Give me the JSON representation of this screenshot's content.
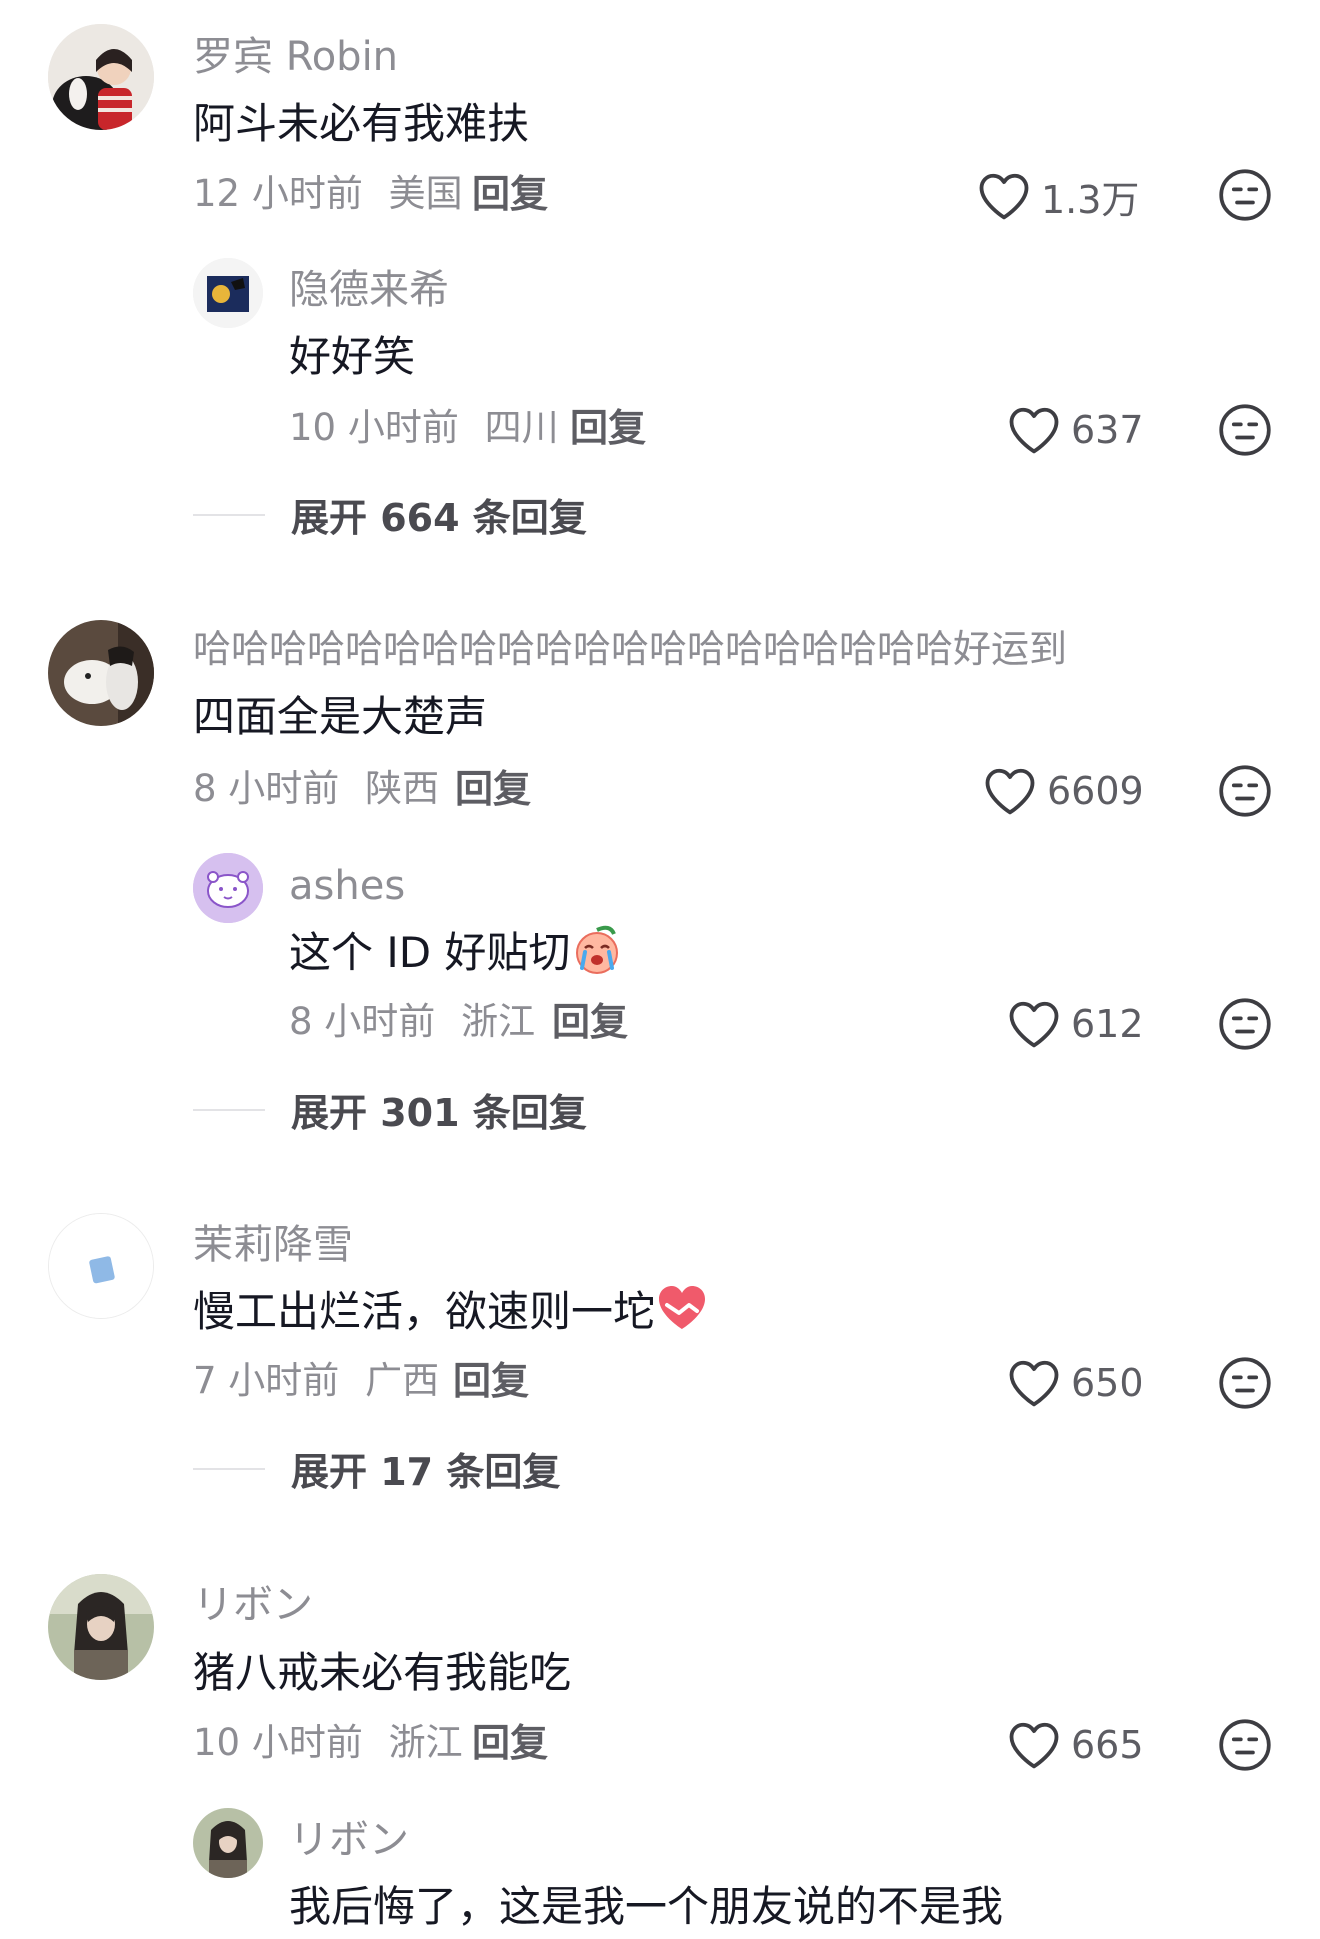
{
  "comments": [
    {
      "user": "罗宾 Robin",
      "text": "阿斗未必有我难扶",
      "time": "12 小时前",
      "location": "美国",
      "reply_label": "回复",
      "likes": "1.3万",
      "replies": [
        {
          "user": "隐德来希",
          "text": "好好笑",
          "time": "10 小时前",
          "location": "四川",
          "reply_label": "回复",
          "likes": "637"
        }
      ],
      "expand_label": "展开 664 条回复"
    },
    {
      "user": "哈哈哈哈哈哈哈哈哈哈哈哈哈哈哈哈哈哈哈哈好运到",
      "text": "四面全是大楚声",
      "time": "8 小时前",
      "location": "陕西",
      "reply_label": "回复",
      "likes": "6609",
      "replies": [
        {
          "user": "ashes",
          "text": "这个 ID 好贴切",
          "time": "8 小时前",
          "location": "浙江",
          "reply_label": "回复",
          "likes": "612"
        }
      ],
      "expand_label": "展开 301 条回复"
    },
    {
      "user": "茉莉降雪",
      "text": "慢工出烂活，欲速则一坨",
      "time": "7 小时前",
      "location": "广西",
      "reply_label": "回复",
      "likes": "650",
      "expand_label": "展开 17 条回复"
    },
    {
      "user": "リボン",
      "text": "猪八戒未必有我能吃",
      "time": "10 小时前",
      "location": "浙江",
      "reply_label": "回复",
      "likes": "665",
      "replies": [
        {
          "user": "リボン",
          "text": "我后悔了，这是我一个朋友说的不是我"
        }
      ]
    }
  ],
  "icons": {
    "like": "heart-outline-icon",
    "dislike": "neutral-face-icon"
  },
  "colors": {
    "name": "#8d8d93",
    "text": "#161823",
    "meta": "#8d8d93",
    "action": "#5d5d63"
  }
}
